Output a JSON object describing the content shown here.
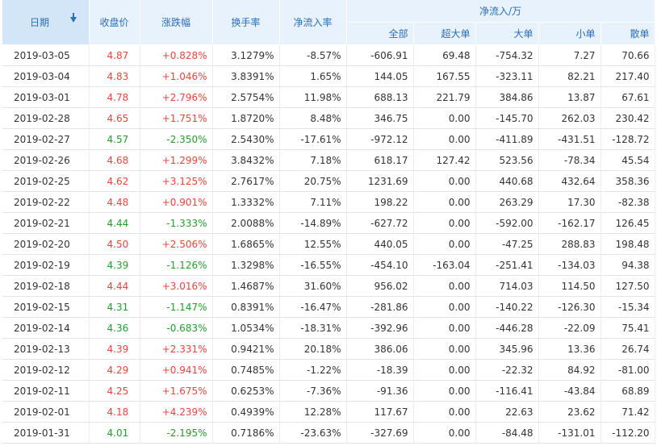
{
  "colors": {
    "header_bg": "#e7f2fc",
    "header_text": "#2e6fb5",
    "up": "#e8453c",
    "down": "#259c2e"
  },
  "headers": {
    "date": "日期",
    "close": "收盘价",
    "change": "涨跌幅",
    "turnover": "换手率",
    "net_inflow_rate": "净流入率",
    "net_inflow_group": "净流入/万",
    "all": "全部",
    "super_large": "超大单",
    "large": "大单",
    "small": "小单",
    "retail": "散单",
    "sort_icon": "sort-down-arrow-icon"
  },
  "rows": [
    {
      "date": "2019-03-05",
      "close": "4.87",
      "change": "+0.828%",
      "turnover": "3.1279%",
      "rate": "-8.57%",
      "all": "-606.91",
      "super": "69.48",
      "large": "-754.32",
      "small": "7.27",
      "retail": "70.66",
      "dir": "up"
    },
    {
      "date": "2019-03-04",
      "close": "4.83",
      "change": "+1.046%",
      "turnover": "3.8391%",
      "rate": "1.65%",
      "all": "144.05",
      "super": "167.55",
      "large": "-323.11",
      "small": "82.21",
      "retail": "217.40",
      "dir": "up"
    },
    {
      "date": "2019-03-01",
      "close": "4.78",
      "change": "+2.796%",
      "turnover": "2.5754%",
      "rate": "11.98%",
      "all": "688.13",
      "super": "221.79",
      "large": "384.86",
      "small": "13.87",
      "retail": "67.61",
      "dir": "up"
    },
    {
      "date": "2019-02-28",
      "close": "4.65",
      "change": "+1.751%",
      "turnover": "1.8720%",
      "rate": "8.48%",
      "all": "346.75",
      "super": "0.00",
      "large": "-145.70",
      "small": "262.03",
      "retail": "230.42",
      "dir": "up"
    },
    {
      "date": "2019-02-27",
      "close": "4.57",
      "change": "-2.350%",
      "turnover": "2.5430%",
      "rate": "-17.61%",
      "all": "-972.12",
      "super": "0.00",
      "large": "-411.89",
      "small": "-431.51",
      "retail": "-128.72",
      "dir": "down"
    },
    {
      "date": "2019-02-26",
      "close": "4.68",
      "change": "+1.299%",
      "turnover": "3.8432%",
      "rate": "7.18%",
      "all": "618.17",
      "super": "127.42",
      "large": "523.56",
      "small": "-78.34",
      "retail": "45.54",
      "dir": "up"
    },
    {
      "date": "2019-02-25",
      "close": "4.62",
      "change": "+3.125%",
      "turnover": "2.7617%",
      "rate": "20.75%",
      "all": "1231.69",
      "super": "0.00",
      "large": "440.68",
      "small": "432.64",
      "retail": "358.36",
      "dir": "up"
    },
    {
      "date": "2019-02-22",
      "close": "4.48",
      "change": "+0.901%",
      "turnover": "1.3332%",
      "rate": "7.11%",
      "all": "198.22",
      "super": "0.00",
      "large": "263.29",
      "small": "17.30",
      "retail": "-82.38",
      "dir": "up"
    },
    {
      "date": "2019-02-21",
      "close": "4.44",
      "change": "-1.333%",
      "turnover": "2.0088%",
      "rate": "-14.89%",
      "all": "-627.72",
      "super": "0.00",
      "large": "-592.00",
      "small": "-162.17",
      "retail": "126.45",
      "dir": "down"
    },
    {
      "date": "2019-02-20",
      "close": "4.50",
      "change": "+2.506%",
      "turnover": "1.6865%",
      "rate": "12.55%",
      "all": "440.05",
      "super": "0.00",
      "large": "-47.25",
      "small": "288.83",
      "retail": "198.48",
      "dir": "up"
    },
    {
      "date": "2019-02-19",
      "close": "4.39",
      "change": "-1.126%",
      "turnover": "1.3298%",
      "rate": "-16.55%",
      "all": "-454.10",
      "super": "-163.04",
      "large": "-251.41",
      "small": "-134.03",
      "retail": "94.38",
      "dir": "down"
    },
    {
      "date": "2019-02-18",
      "close": "4.44",
      "change": "+3.016%",
      "turnover": "1.4687%",
      "rate": "31.60%",
      "all": "956.02",
      "super": "0.00",
      "large": "714.03",
      "small": "114.50",
      "retail": "127.50",
      "dir": "up"
    },
    {
      "date": "2019-02-15",
      "close": "4.31",
      "change": "-1.147%",
      "turnover": "0.8391%",
      "rate": "-16.47%",
      "all": "-281.86",
      "super": "0.00",
      "large": "-140.22",
      "small": "-126.30",
      "retail": "-15.34",
      "dir": "down"
    },
    {
      "date": "2019-02-14",
      "close": "4.36",
      "change": "-0.683%",
      "turnover": "1.0534%",
      "rate": "-18.31%",
      "all": "-392.96",
      "super": "0.00",
      "large": "-446.28",
      "small": "-22.09",
      "retail": "75.41",
      "dir": "down"
    },
    {
      "date": "2019-02-13",
      "close": "4.39",
      "change": "+2.331%",
      "turnover": "0.9421%",
      "rate": "20.18%",
      "all": "386.06",
      "super": "0.00",
      "large": "345.96",
      "small": "13.36",
      "retail": "26.74",
      "dir": "up"
    },
    {
      "date": "2019-02-12",
      "close": "4.29",
      "change": "+0.941%",
      "turnover": "0.7485%",
      "rate": "-1.22%",
      "all": "-18.39",
      "super": "0.00",
      "large": "-22.32",
      "small": "84.92",
      "retail": "-81.00",
      "dir": "up"
    },
    {
      "date": "2019-02-11",
      "close": "4.25",
      "change": "+1.675%",
      "turnover": "0.6253%",
      "rate": "-7.36%",
      "all": "-91.36",
      "super": "0.00",
      "large": "-116.41",
      "small": "-43.84",
      "retail": "68.89",
      "dir": "up"
    },
    {
      "date": "2019-02-01",
      "close": "4.18",
      "change": "+4.239%",
      "turnover": "0.4939%",
      "rate": "12.28%",
      "all": "117.67",
      "super": "0.00",
      "large": "22.63",
      "small": "23.62",
      "retail": "71.42",
      "dir": "up"
    },
    {
      "date": "2019-01-31",
      "close": "4.01",
      "change": "-2.195%",
      "turnover": "0.7186%",
      "rate": "-23.63%",
      "all": "-327.69",
      "super": "0.00",
      "large": "-84.48",
      "small": "-131.01",
      "retail": "-112.20",
      "dir": "down"
    }
  ]
}
